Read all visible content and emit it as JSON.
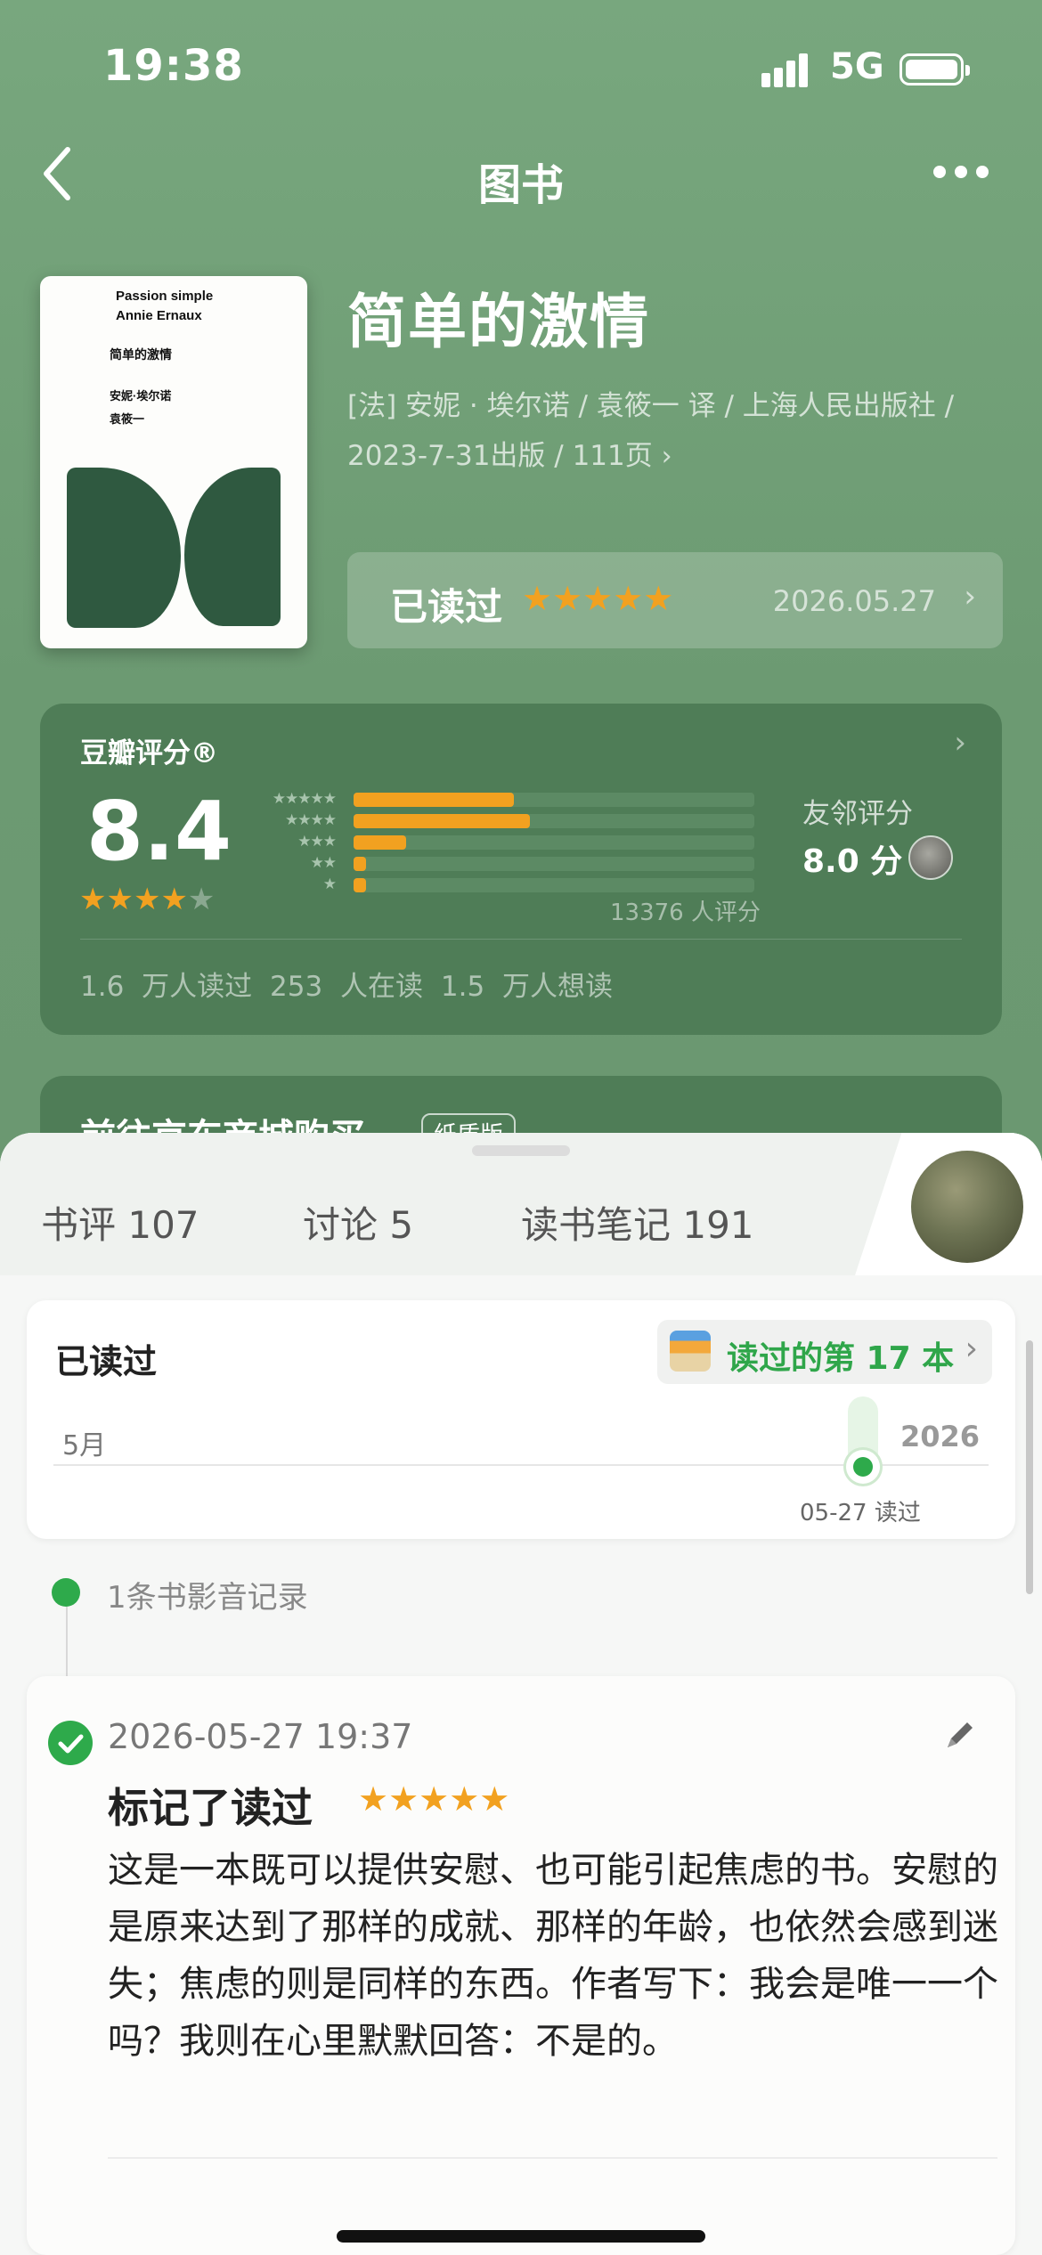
{
  "status": {
    "time": "19:38",
    "network": "5G"
  },
  "nav": {
    "title": "图书"
  },
  "book": {
    "cover_title_en": "Passion simple",
    "cover_author_en": "Annie Ernaux",
    "cover_title_cn": "简单的激情",
    "cover_author_cn": "安妮·埃尔诺",
    "cover_translator": "袁筱一",
    "title": "简单的激情",
    "meta_line1": "[法] 安妮 · 埃尔诺 / 袁筱一 译 / 上海人民出版社 /",
    "meta_line2": "2023-7-31出版 / 111页",
    "read_status": "已读过",
    "read_stars": "★★★★★",
    "read_date": "2026.05.27"
  },
  "rating": {
    "label": "豆瓣评分®",
    "score": "8.4",
    "stars_on": "★★★★",
    "stars_off": "★",
    "distribution": [
      {
        "stars": "★★★★★",
        "fraction": 0.4
      },
      {
        "stars": "★★★★",
        "fraction": 0.44
      },
      {
        "stars": "★★★",
        "fraction": 0.13
      },
      {
        "stars": "★★",
        "fraction": 0.03
      },
      {
        "stars": "★",
        "fraction": 0.03
      }
    ],
    "count": "13376 人评分",
    "friend_label": "友邻评分",
    "friend_score": "8.0 分",
    "stats": "1.6 万人读过   253 人在读   1.5 万人想读"
  },
  "buy": {
    "title": "前往京东商城购买",
    "tag": "纸质版"
  },
  "tabs": [
    {
      "label": "书评 107"
    },
    {
      "label": "讨论 5"
    },
    {
      "label": "读书笔记 191"
    }
  ],
  "reading": {
    "label": "已读过",
    "badge": "读过的第 17 本",
    "month": "5月",
    "year": "2026",
    "mark_date": "05-27 读过"
  },
  "records": {
    "label": "1条书影音记录"
  },
  "entry": {
    "time": "2026-05-27 19:37",
    "title": "标记了读过",
    "stars": "★★★★★",
    "body": "这是一本既可以提供安慰、也可能引起焦虑的书。安慰的是原来达到了那样的成就、那样的年龄，也依然会感到迷失；焦虑的则是同样的东西。作者写下：我会是唯一一个吗？我则在心里默默回答：不是的。"
  },
  "colors": {
    "accent_green": "#2eaa4b",
    "star_orange": "#f2a120",
    "header_green": "#6e9e75"
  }
}
